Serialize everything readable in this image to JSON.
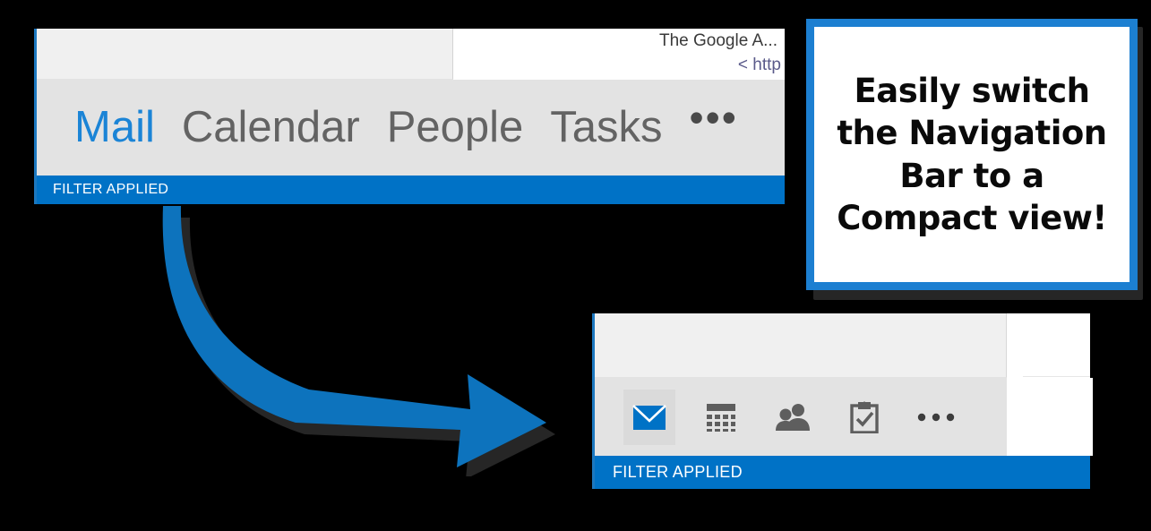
{
  "expanded_view": {
    "email_header": {
      "subject_line": "The Google A...",
      "address_line": "< http"
    },
    "nav_items": [
      {
        "label": "Mail",
        "selected": true
      },
      {
        "label": "Calendar",
        "selected": false
      },
      {
        "label": "People",
        "selected": false
      },
      {
        "label": "Tasks",
        "selected": false
      }
    ],
    "overflow_label": "•••",
    "status_bar": {
      "label": "FILTER APPLIED"
    }
  },
  "callout": {
    "lines": [
      "Easily switch",
      "the Navigation",
      "Bar to a",
      "Compact view!"
    ],
    "border_color": "#1c7fd1"
  },
  "compact_view": {
    "nav_items": [
      {
        "icon": "envelope-icon",
        "label": "Mail",
        "selected": true
      },
      {
        "icon": "calendar-icon",
        "label": "Calendar",
        "selected": false
      },
      {
        "icon": "people-icon",
        "label": "People",
        "selected": false
      },
      {
        "icon": "tasks-clipboard-icon",
        "label": "Tasks",
        "selected": false
      },
      {
        "icon": "overflow-ellipsis-icon",
        "label": "More",
        "selected": false
      }
    ],
    "status_bar": {
      "label": "FILTER APPLIED"
    }
  },
  "colors": {
    "accent_blue": "#0072c6",
    "nav_selected_blue": "#1b84d6",
    "nav_gray": "#636363",
    "navbar_bg": "#e3e3e3",
    "toolbar_bg": "#f0f0f0",
    "arrow_blue": "#0d73bd",
    "arrow_shadow": "#262626",
    "background": "#000000"
  },
  "annotation": {
    "arrow_name": "curved-arrow-pointing-to-compact-view"
  }
}
